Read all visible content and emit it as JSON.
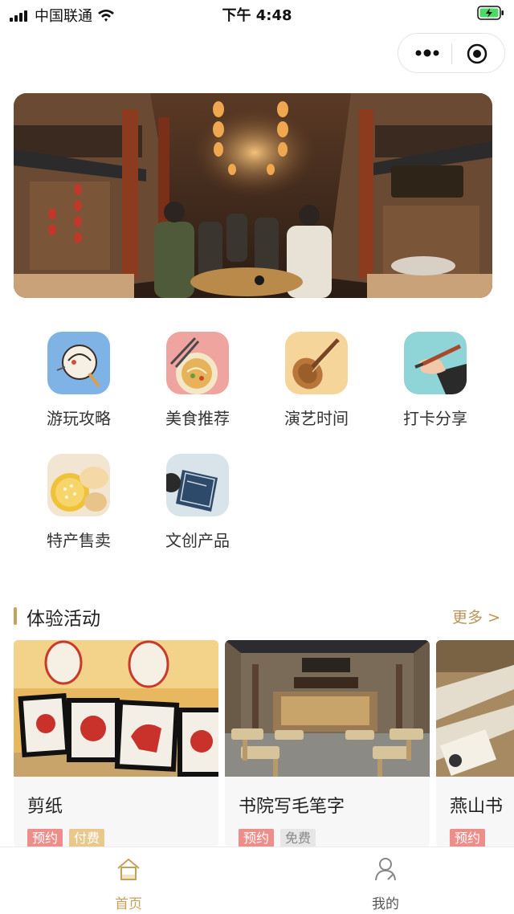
{
  "status_bar": {
    "carrier": "中国联通",
    "time": "下午 4:48"
  },
  "categories": [
    {
      "label": "游玩攻略",
      "icon": "lantern-icon"
    },
    {
      "label": "美食推荐",
      "icon": "noodle-bowl-icon"
    },
    {
      "label": "演艺时间",
      "icon": "pipa-instrument-icon"
    },
    {
      "label": "打卡分享",
      "icon": "hand-brush-icon"
    },
    {
      "label": "特产售卖",
      "icon": "pastry-icon"
    },
    {
      "label": "文创产品",
      "icon": "book-icon"
    }
  ],
  "section": {
    "title": "体验活动",
    "more": "更多 >"
  },
  "activities": [
    {
      "title": "剪纸",
      "tags": [
        {
          "text": "预约",
          "style": "red"
        },
        {
          "text": "付费",
          "style": "gold"
        }
      ]
    },
    {
      "title": "书院写毛笔字",
      "tags": [
        {
          "text": "预约",
          "style": "red"
        },
        {
          "text": "免费",
          "style": "grey"
        }
      ]
    },
    {
      "title": "燕山书",
      "tags": [
        {
          "text": "预约",
          "style": "red"
        }
      ]
    }
  ],
  "tab_bar": {
    "home_label": "首页",
    "mine_label": "我的",
    "active_color": "#c8a05a",
    "inactive_color": "#555555"
  }
}
